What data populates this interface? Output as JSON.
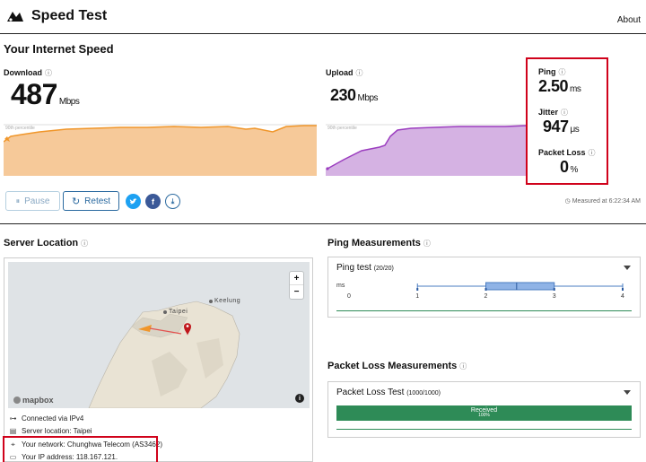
{
  "header": {
    "app_title": "Speed Test",
    "about_label": "About"
  },
  "speed": {
    "section_title": "Your Internet Speed",
    "download": {
      "label": "Download",
      "value": "487",
      "unit": "Mbps",
      "color": "#f0962a"
    },
    "upload": {
      "label": "Upload",
      "value": "230",
      "unit": "Mbps",
      "color": "#9b3dbf"
    },
    "percentile_label": "90th percentile",
    "ping": {
      "label": "Ping",
      "value": "2.50",
      "unit": "ms"
    },
    "jitter": {
      "label": "Jitter",
      "value": "947",
      "unit": "μs"
    },
    "packet_loss": {
      "label": "Packet Loss",
      "value": "0",
      "unit": "%"
    },
    "info_icon": "ⓘ"
  },
  "actions": {
    "pause_label": "Pause",
    "retest_label": "Retest",
    "measured_text": "Measured at 6:22:34 AM"
  },
  "server": {
    "section_title": "Server Location",
    "map": {
      "city_taipei": "Taipei",
      "city_keelung": "Keelung",
      "attribution": "mapbox",
      "zoom_in": "+",
      "zoom_out": "−",
      "info": "i"
    },
    "rows": [
      "Connected via IPv4",
      "Server location: Taipei",
      "Your network: Chunghwa Telecom (AS3462)",
      "Your IP address: 118.167.121."
    ]
  },
  "ping_measurements": {
    "section_title": "Ping Measurements",
    "card_title": "Ping test",
    "count": "(20/20)",
    "unit_label": "ms",
    "ticks": [
      "0",
      "1",
      "2",
      "3",
      "4"
    ],
    "box": {
      "whisker_min": 1.0,
      "q1": 2.0,
      "median": 2.45,
      "q3": 3.0,
      "whisker_max": 4.0,
      "axis_max": 4.0
    }
  },
  "packet_loss_measurements": {
    "section_title": "Packet Loss Measurements",
    "card_title": "Packet Loss Test",
    "count": "(1000/1000)",
    "received_label": "Received",
    "received_percent_label": "100%",
    "received_fraction": 1.0,
    "color": "#2e8b57"
  },
  "colors": {
    "highlight": "#d0021b",
    "twitter": "#1da1f2",
    "facebook": "#3b5998",
    "accent": "#2b6aa0"
  }
}
